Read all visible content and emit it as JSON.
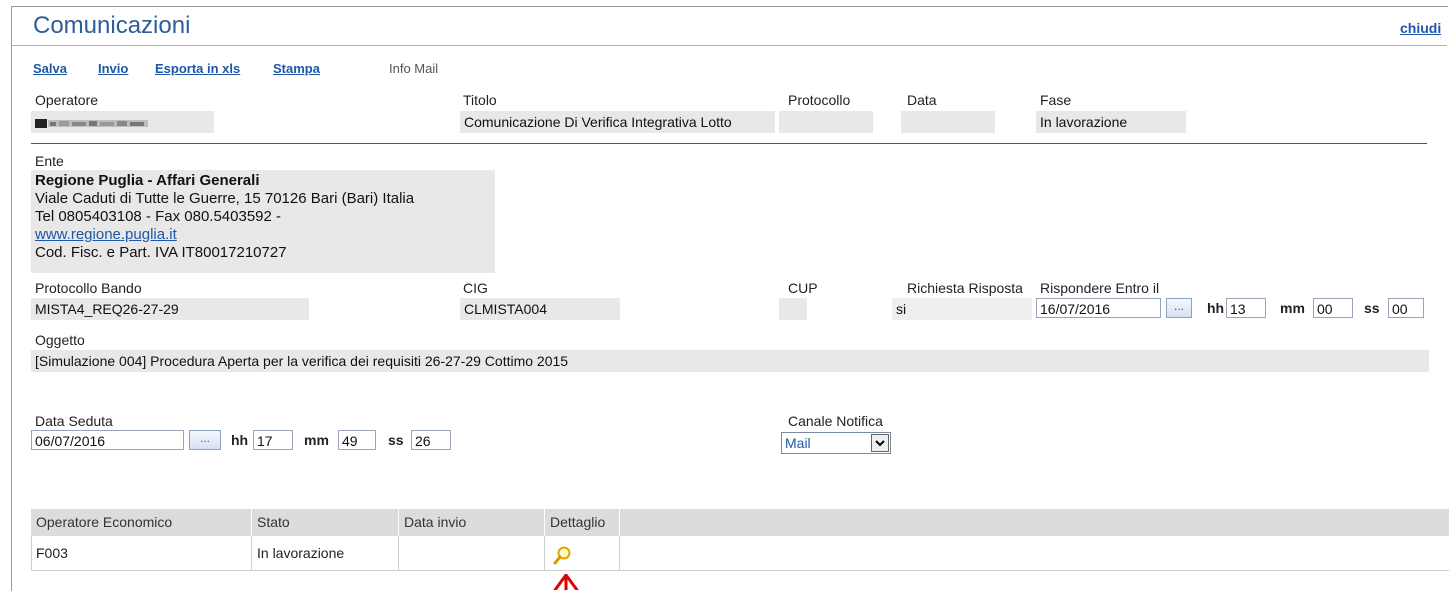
{
  "window": {
    "title": "Comunicazioni",
    "close_label": "chiudi"
  },
  "toolbar": {
    "salva": "Salva",
    "invio": "Invio",
    "esporta": "Esporta in xls",
    "stampa": "Stampa",
    "info_mail": "Info Mail"
  },
  "header": {
    "operatore_label": "Operatore",
    "titolo_label": "Titolo",
    "titolo_value": "Comunicazione Di Verifica Integrativa Lotto",
    "protocollo_label": "Protocollo",
    "protocollo_value": "",
    "data_label": "Data",
    "data_value": "",
    "fase_label": "Fase",
    "fase_value": "In lavorazione"
  },
  "ente": {
    "label": "Ente",
    "name": "Regione Puglia - Affari Generali",
    "address": "Viale Caduti di Tutte le Guerre, 15 70126 Bari (Bari) Italia",
    "phone": "Tel 0805403108 - Fax 080.5403592 -",
    "website": "www.regione.puglia.it",
    "fiscal": "Cod. Fisc. e Part. IVA IT80017210727"
  },
  "bando": {
    "protocollo_label": "Protocollo Bando",
    "protocollo_value": "MISTA4_REQ26-27-29",
    "cig_label": "CIG",
    "cig_value": "CLMISTA004",
    "cup_label": "CUP",
    "cup_value": "",
    "richiesta_label": "Richiesta Risposta",
    "richiesta_value": "si",
    "rispondere_label": "Rispondere Entro il",
    "rispondere_date": "16/07/2016",
    "rispondere_hh": "13",
    "rispondere_mm": "00",
    "rispondere_ss": "00"
  },
  "oggetto": {
    "label": "Oggetto",
    "value": "[Simulazione 004] Procedura Aperta per la verifica dei requisiti 26-27-29 Cottimo 2015"
  },
  "seduta": {
    "label": "Data Seduta",
    "date": "06/07/2016",
    "hh": "17",
    "mm": "49",
    "ss": "26"
  },
  "time_units": {
    "hh": "hh",
    "mm": "mm",
    "ss": "ss",
    "picker": "..."
  },
  "canale": {
    "label": "Canale Notifica",
    "selected": "Mail"
  },
  "table": {
    "columns": [
      "Operatore Economico",
      "Stato",
      "Data invio",
      "Dettaglio"
    ],
    "rows": [
      {
        "operatore": "F003",
        "stato": "In lavorazione",
        "data_invio": ""
      }
    ]
  },
  "colors": {
    "link": "#1f57a8",
    "title": "#2d5d9a",
    "field_bg": "#e8e8e8",
    "header_bg": "#dcdcdc",
    "arrow": "#e00000"
  },
  "icons": {
    "dettaglio": "magnifier-icon",
    "pointer": "red-arrow-icon",
    "redacted": "redacted-name"
  }
}
